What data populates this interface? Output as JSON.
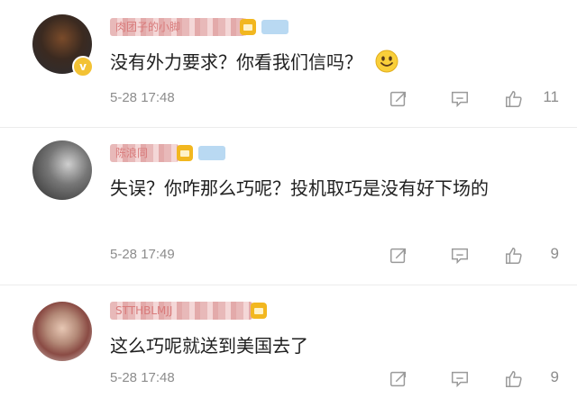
{
  "comments": [
    {
      "username": "肉团子的小脚",
      "text": "没有外力要求？你看我们信吗？",
      "emoji": "smile-emoji",
      "time": "5-28 17:48",
      "likes": "11"
    },
    {
      "username": "陈浪同",
      "text": "失误？你咋那么巧呢？投机取巧是没有好下场的",
      "time": "5-28 17:49",
      "likes": "9"
    },
    {
      "username": "STTHBLMJJ",
      "text": "这么巧呢就送到美国去了",
      "time": "5-28 17:48",
      "likes": "9"
    }
  ],
  "icons": {
    "forward": "forward-icon",
    "reply": "reply-icon",
    "like": "thumbs-up-icon"
  },
  "colors": {
    "text": "#1f1f1f",
    "meta": "#8c8c8c",
    "vip_badge": "#f2b71f",
    "level_badge": "#b9d9f2"
  }
}
